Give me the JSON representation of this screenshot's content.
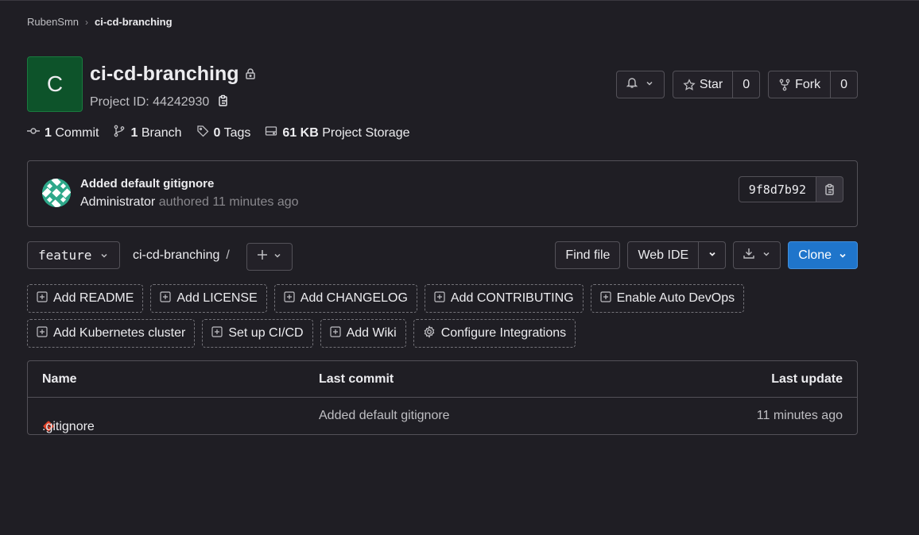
{
  "breadcrumb": {
    "namespace": "RubenSmn",
    "project": "ci-cd-branching"
  },
  "project": {
    "avatar_letter": "C",
    "name": "ci-cd-branching",
    "id_label": "Project ID: 44242930",
    "avatar_color": "#0d532a"
  },
  "header_buttons": {
    "star_label": "Star",
    "star_count": "0",
    "fork_label": "Fork",
    "fork_count": "0"
  },
  "stats": {
    "commits_count": "1",
    "commits_label": "Commit",
    "branches_count": "1",
    "branches_label": "Branch",
    "tags_count": "0",
    "tags_label": "Tags",
    "storage_count": "61 KB",
    "storage_label": "Project Storage"
  },
  "last_commit": {
    "title": "Added default gitignore",
    "author": "Administrator",
    "authored_text": "authored 11 minutes ago",
    "sha": "9f8d7b92"
  },
  "toolbar": {
    "branch": "feature",
    "path": "ci-cd-branching",
    "path_sep": "/",
    "find_file": "Find file",
    "web_ide": "Web IDE",
    "clone": "Clone",
    "clone_color": "#1f75cb"
  },
  "quick_actions_row1": [
    "Add README",
    "Add LICENSE",
    "Add CHANGELOG",
    "Add CONTRIBUTING",
    "Enable Auto DevOps"
  ],
  "quick_actions_row2": [
    "Add Kubernetes cluster",
    "Set up CI/CD",
    "Add Wiki",
    "Configure Integrations"
  ],
  "file_table": {
    "headers": {
      "name": "Name",
      "last_commit": "Last commit",
      "last_update": "Last update"
    },
    "rows": [
      {
        "name": ".gitignore",
        "last_commit": "Added default gitignore",
        "last_update": "11 minutes ago"
      }
    ]
  }
}
